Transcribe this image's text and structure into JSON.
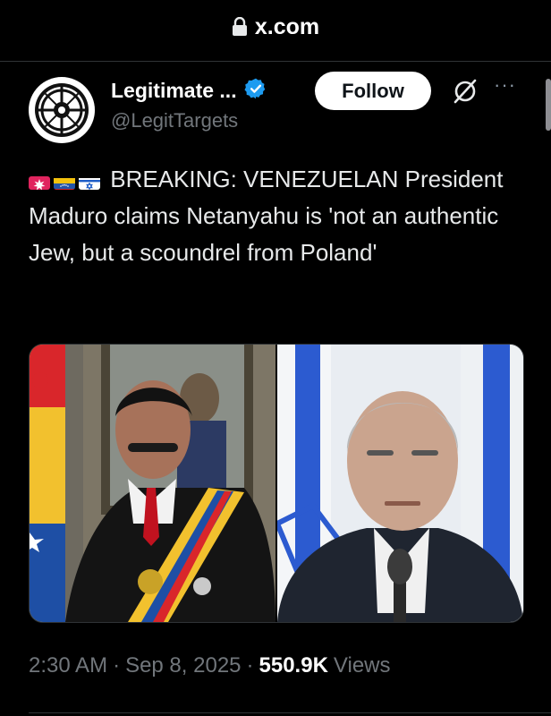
{
  "topbar": {
    "url": "x.com"
  },
  "author": {
    "name": "Legitimate ...",
    "handle": "@LegitTargets",
    "verified": true
  },
  "header": {
    "follow_label": "Follow",
    "more_label": "···"
  },
  "tweet": {
    "emojis": [
      "rotating-light-emoji",
      "venezuela-flag-emoji",
      "israel-flag-emoji"
    ],
    "text": "BREAKING: VENEZUELAN President Maduro claims Netanyahu is 'not an authentic Jew, but a scoundrel from Poland'"
  },
  "media": {
    "images": [
      "photo-of-man-with-presidential-sash",
      "photo-of-man-in-front-of-flags"
    ]
  },
  "meta": {
    "time": "2:30 AM",
    "sep1": "·",
    "date": "Sep 8, 2025",
    "sep2": "·",
    "views_count": "550.9K",
    "views_label": "Views"
  },
  "colors": {
    "background": "#000000",
    "text": "#e7e9ea",
    "muted": "#71767b",
    "verified": "#1d9bf0",
    "follow_bg": "#ffffff"
  }
}
